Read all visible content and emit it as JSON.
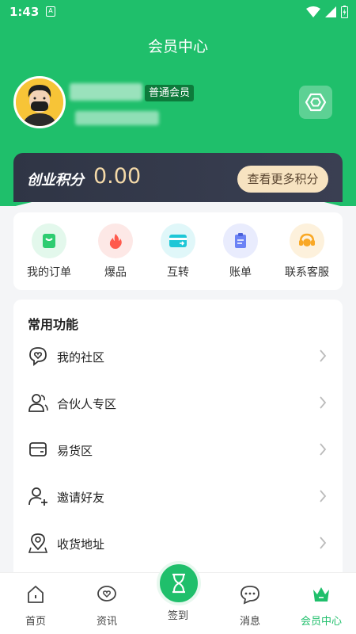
{
  "status_bar": {
    "time": "1:43",
    "notification_badge": "A"
  },
  "header": {
    "title": "会员中心",
    "member_level": "普通会员"
  },
  "points": {
    "label": "创业积分",
    "value": "0.00",
    "more_button": "查看更多积分"
  },
  "quick_actions": [
    {
      "label": "我的订单",
      "icon": "order-icon",
      "color": "#2ecc71",
      "bg": "#e3f8ec"
    },
    {
      "label": "爆品",
      "icon": "fire-icon",
      "color": "#ff5a4d",
      "bg": "#fde8e6"
    },
    {
      "label": "互转",
      "icon": "transfer-card-icon",
      "color": "#1ec7d7",
      "bg": "#e0f7f9"
    },
    {
      "label": "账单",
      "icon": "bill-icon",
      "color": "#6b82f5",
      "bg": "#e9ecfd"
    },
    {
      "label": "联系客服",
      "icon": "customer-service-icon",
      "color": "#f9a825",
      "bg": "#fdf1dc"
    }
  ],
  "functions": {
    "title": "常用功能",
    "items": [
      {
        "label": "我的社区",
        "icon": "community-heart-icon"
      },
      {
        "label": "合伙人专区",
        "icon": "partners-icon"
      },
      {
        "label": "易货区",
        "icon": "wallet-icon"
      },
      {
        "label": "邀请好友",
        "icon": "add-user-icon"
      },
      {
        "label": "收货地址",
        "icon": "location-icon"
      }
    ]
  },
  "tabbar": {
    "home": "首页",
    "news": "资讯",
    "signin": "签到",
    "messages": "消息",
    "member": "会员中心"
  },
  "colors": {
    "brand": "#1fbf6b",
    "points_bg": "#2f3545",
    "points_accent": "#f4d9a8"
  }
}
